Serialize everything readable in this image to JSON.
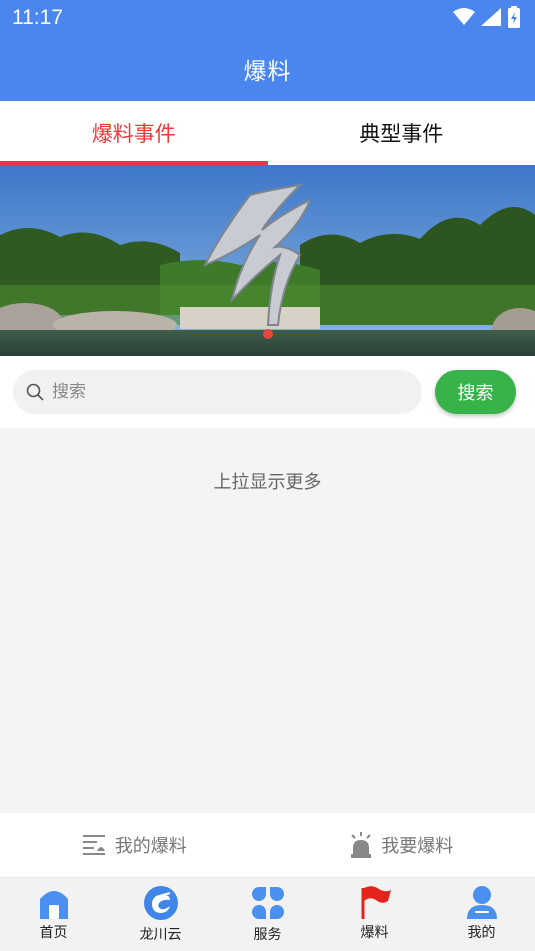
{
  "status_bar": {
    "time": "11:17"
  },
  "header": {
    "title": "爆料"
  },
  "tabs": [
    {
      "label": "爆料事件",
      "active": true
    },
    {
      "label": "典型事件",
      "active": false
    }
  ],
  "search": {
    "placeholder": "搜索",
    "button_label": "搜索"
  },
  "content": {
    "load_more_text": "上拉显示更多"
  },
  "actions": [
    {
      "label": "我的爆料",
      "icon": "list-icon"
    },
    {
      "label": "我要爆料",
      "icon": "alarm-icon"
    }
  ],
  "bottom_nav": [
    {
      "label": "首页",
      "icon": "home-icon"
    },
    {
      "label": "龙川云",
      "icon": "cloud-logo-icon"
    },
    {
      "label": "服务",
      "icon": "grid-icon"
    },
    {
      "label": "爆料",
      "icon": "flag-icon",
      "active": true
    },
    {
      "label": "我的",
      "icon": "user-icon"
    }
  ],
  "colors": {
    "primary": "#4a86ee",
    "accent_red": "#e83a3a",
    "search_green": "#38b34a"
  }
}
